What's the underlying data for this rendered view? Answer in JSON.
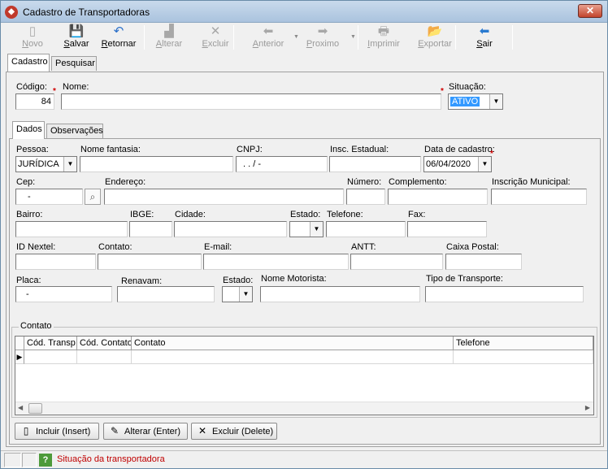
{
  "window": {
    "title": "Cadastro de Transportadoras",
    "close_glyph": "✕"
  },
  "toolbar": [
    {
      "label": "Novo",
      "icon": "new-document-icon",
      "glyph": "▯",
      "enabled": false
    },
    {
      "label": "Salvar",
      "icon": "floppy-disk-icon",
      "glyph": "💾",
      "enabled": true
    },
    {
      "label": "Retornar",
      "icon": "undo-arrow-icon",
      "glyph": "↶",
      "enabled": true
    },
    {
      "label": "Alterar",
      "icon": "edit-icon",
      "glyph": "▟",
      "enabled": false
    },
    {
      "label": "Excluir",
      "icon": "delete-x-icon",
      "glyph": "✕",
      "enabled": false
    },
    {
      "label": "Anterior",
      "icon": "arrow-left-icon",
      "glyph": "⬅",
      "enabled": false
    },
    {
      "label": "Proximo",
      "icon": "arrow-right-icon",
      "glyph": "➡",
      "enabled": false
    },
    {
      "label": "Imprimir",
      "icon": "printer-icon",
      "glyph": "🖶",
      "enabled": false
    },
    {
      "label": "Exportar",
      "icon": "export-icon",
      "glyph": "📂",
      "enabled": false
    },
    {
      "label": "Sair",
      "icon": "exit-arrow-icon",
      "glyph": "⬅",
      "enabled": true
    }
  ],
  "main_tabs": [
    "Cadastro",
    "Pesquisar"
  ],
  "header": {
    "codigo_label": "Código:",
    "codigo_value": "84",
    "nome_label": "Nome:",
    "nome_value": "",
    "situacao_label": "Situação:",
    "situacao_value": "ATIVO"
  },
  "sub_tabs": [
    "Dados",
    "Observações"
  ],
  "fields": {
    "pessoa_label": "Pessoa:",
    "pessoa_value": "JURÍDICA",
    "fantasia_label": "Nome fantasia:",
    "cnpj_label": "CNPJ:",
    "cnpj_value": ".  .   /    -",
    "insc_estadual_label": "Insc. Estadual:",
    "data_cadastro_label": "Data de cadastro:",
    "data_cadastro_value": "06/04/2020",
    "cep_label": "Cep:",
    "cep_value": "-",
    "endereco_label": "Endereço:",
    "numero_label": "Número:",
    "complemento_label": "Complemento:",
    "insc_municipal_label": "Inscrição Municipal:",
    "bairro_label": "Bairro:",
    "ibge_label": "IBGE:",
    "cidade_label": "Cidade:",
    "estado_label": "Estado:",
    "telefone_label": "Telefone:",
    "fax_label": "Fax:",
    "id_nextel_label": "ID Nextel:",
    "contato_label": "Contato:",
    "email_label": "E-mail:",
    "antt_label": "ANTT:",
    "caixa_postal_label": "Caixa Postal:",
    "placa_label": "Placa:",
    "placa_value": "-",
    "renavam_label": "Renavam:",
    "estado2_label": "Estado:",
    "nome_motorista_label": "Nome Motorista:",
    "tipo_transporte_label": "Tipo de Transporte:"
  },
  "contato_group": {
    "title": "Contato",
    "columns": [
      "Cód. Transp",
      "Cód. Contato",
      "Contato",
      "Telefone"
    ]
  },
  "buttons": {
    "incluir": "Incluir (Insert)",
    "alterar": "Alterar (Enter)",
    "excluir": "Excluir (Delete)"
  },
  "status": {
    "text": "Situação da transportadora",
    "help_glyph": "?"
  },
  "colors": {
    "selection": "#3399ff",
    "required": "#d00000",
    "status_text": "#c00000"
  }
}
